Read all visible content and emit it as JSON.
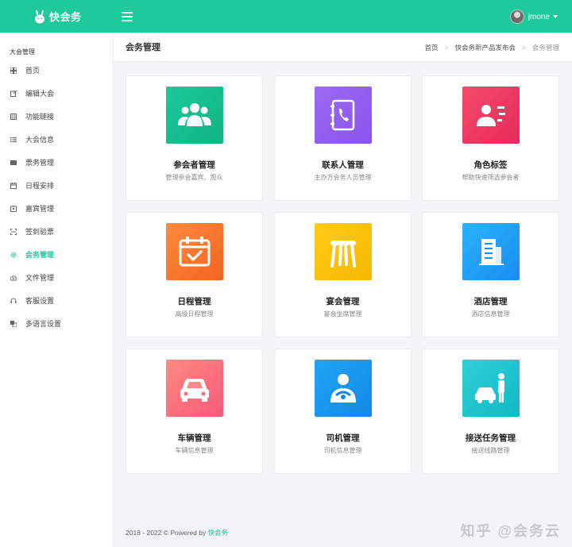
{
  "app": {
    "name": "快会务",
    "user": "jmone"
  },
  "sidebar": {
    "section_title": "大会管理",
    "items": [
      {
        "label": "首页",
        "icon": "dashboard-icon"
      },
      {
        "label": "编辑大会",
        "icon": "edit-icon"
      },
      {
        "label": "功能链接",
        "icon": "grid-icon"
      },
      {
        "label": "大会信息",
        "icon": "list-icon"
      },
      {
        "label": "票务管理",
        "icon": "ticket-icon"
      },
      {
        "label": "日程安排",
        "icon": "calendar-icon"
      },
      {
        "label": "嘉宾管理",
        "icon": "badge-icon"
      },
      {
        "label": "签到验票",
        "icon": "scan-icon"
      },
      {
        "label": "会务管理",
        "icon": "gear-icon",
        "active": true
      },
      {
        "label": "文件管理",
        "icon": "cloud-icon"
      },
      {
        "label": "客服设置",
        "icon": "headset-icon"
      },
      {
        "label": "多语言设置",
        "icon": "language-icon"
      }
    ]
  },
  "header": {
    "title": "会务管理",
    "breadcrumb": [
      "首页",
      "快会务新产品发布会",
      "会务管理"
    ],
    "separator": ">"
  },
  "cards": [
    {
      "title": "参会者管理",
      "subtitle": "管理参会嘉宾、观众",
      "icon": "users-icon",
      "gradient": [
        "#19c99a",
        "#12b385"
      ]
    },
    {
      "title": "联系人管理",
      "subtitle": "主办方会务人员管理",
      "icon": "phonebook-icon",
      "gradient": [
        "#9b6cf0",
        "#8a52f0"
      ]
    },
    {
      "title": "角色标签",
      "subtitle": "帮助快速筛选参会者",
      "icon": "id-card-icon",
      "gradient": [
        "#f34b6b",
        "#e8295a"
      ]
    },
    {
      "title": "日程管理",
      "subtitle": "高级日程管理",
      "icon": "calendar-check-icon",
      "gradient": [
        "#ff8a3d",
        "#f26522"
      ]
    },
    {
      "title": "宴会管理",
      "subtitle": "宴会坐席管理",
      "icon": "stool-icon",
      "gradient": [
        "#ffcc1a",
        "#f5b800"
      ]
    },
    {
      "title": "酒店管理",
      "subtitle": "酒店信息管理",
      "icon": "building-icon",
      "gradient": [
        "#2ab2ff",
        "#1a8df0"
      ]
    },
    {
      "title": "车辆管理",
      "subtitle": "车辆信息管理",
      "icon": "car-icon",
      "gradient": [
        "#ff8a80",
        "#f75a7a"
      ]
    },
    {
      "title": "司机管理",
      "subtitle": "司机信息管理",
      "icon": "driver-icon",
      "gradient": [
        "#1fa5f5",
        "#1488e6"
      ]
    },
    {
      "title": "接送任务管理",
      "subtitle": "接送线路管理",
      "icon": "pickup-icon",
      "gradient": [
        "#2ed1d8",
        "#13b8c4"
      ]
    }
  ],
  "footer": {
    "text": "2018 - 2022 © Powered by ",
    "brand": "快会务"
  },
  "watermark": "知乎 @会务云",
  "colors": {
    "primary": "#1ec99e"
  }
}
